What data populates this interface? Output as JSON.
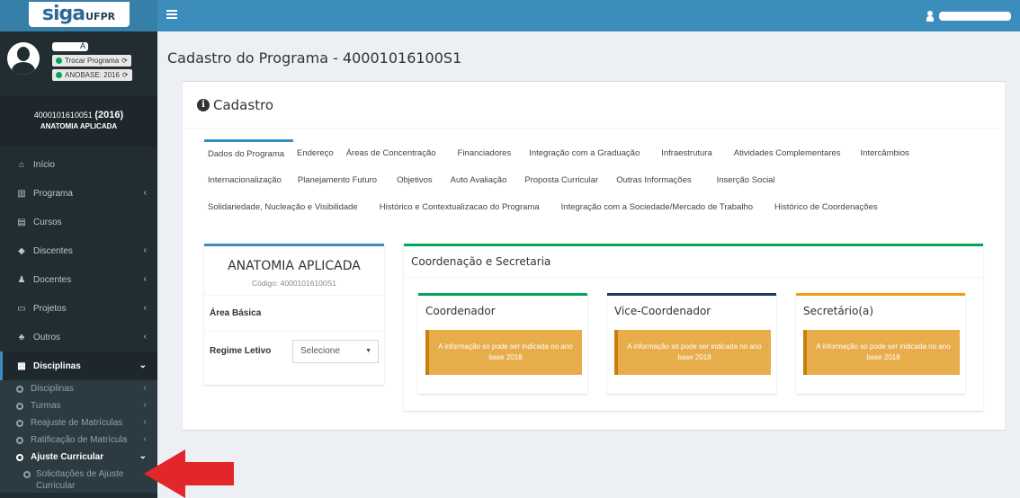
{
  "logo": {
    "siga": "SIGA",
    "ufpr": "UFPR"
  },
  "user": {
    "name_fragment": "A",
    "trocar_programa": "Trocar Programa",
    "anobase": "ANOBASE: 2016"
  },
  "program": {
    "code": "4000101610051",
    "year": "(2016)",
    "name": "ANATOMIA APLICADA"
  },
  "sidebar": {
    "items": [
      {
        "label": "Início",
        "icon": "home-icon"
      },
      {
        "label": "Programa",
        "icon": "institution-icon"
      },
      {
        "label": "Cursos",
        "icon": "list-icon"
      },
      {
        "label": "Discentes",
        "icon": "graduation-icon"
      },
      {
        "label": "Docentes",
        "icon": "users-icon"
      },
      {
        "label": "Projetos",
        "icon": "folder-icon"
      },
      {
        "label": "Outros",
        "icon": "group-icon"
      },
      {
        "label": "Disciplinas",
        "icon": "table-icon"
      }
    ],
    "subitems": [
      {
        "label": "Disciplinas"
      },
      {
        "label": "Turmas"
      },
      {
        "label": "Reajuste de Matrículas"
      },
      {
        "label": "Ratificação de Matrícula"
      },
      {
        "label": "Ajuste Curricular"
      }
    ],
    "subsub": {
      "label": "Solicitações de Ajuste Curricular"
    }
  },
  "content": {
    "title": "Cadastro do Programa - 40001016100S1"
  },
  "card": {
    "title": "Cadastro"
  },
  "tabs": {
    "row1": [
      "Dados do Programa",
      "Endereço",
      "Áreas de Concentração",
      "Financiadores",
      "Integração com a Graduação",
      "Infraestrutura",
      "Atividades Complementares",
      "Intercâmbios"
    ],
    "row2": [
      "Internacionalização",
      "Planejamento Futuro",
      "Objetivos",
      "Auto Avaliação",
      "Proposta Curricular",
      "Outras Informações",
      "Inserção Social"
    ],
    "row3": [
      "Solidariedade, Nucleação e Visibilidade",
      "Histórico e Contextualizacao do Programa",
      "Integração com a Sociedade/Mercado de Trabalho",
      "Histórico de Coordenações"
    ]
  },
  "left_panel": {
    "name": "ANATOMIA APLICADA",
    "code": "Código: 40001016100S1",
    "area_label": "Área Básica",
    "regime_label": "Regime Letivo",
    "regime_value": "Selecione"
  },
  "right_panel": {
    "title": "Coordenação e Secretaria",
    "roles": [
      {
        "title": "Coordenador",
        "message": "A informação só pode ser indicada no ano base 2018",
        "color": "#00a65a"
      },
      {
        "title": "Vice-Coordenador",
        "message": "A informação só pode ser indicada no ano base 2018",
        "color": "#1e3a5c"
      },
      {
        "title": "Secretário(a)",
        "message": "A informação só pode ser indicada no ano base 2018",
        "color": "#f39c12"
      }
    ]
  },
  "colors": {
    "sidebar": "#222d32",
    "topbar": "#3c8dbc",
    "warning": "#e8ad4b",
    "arrow": "#e3262a"
  }
}
